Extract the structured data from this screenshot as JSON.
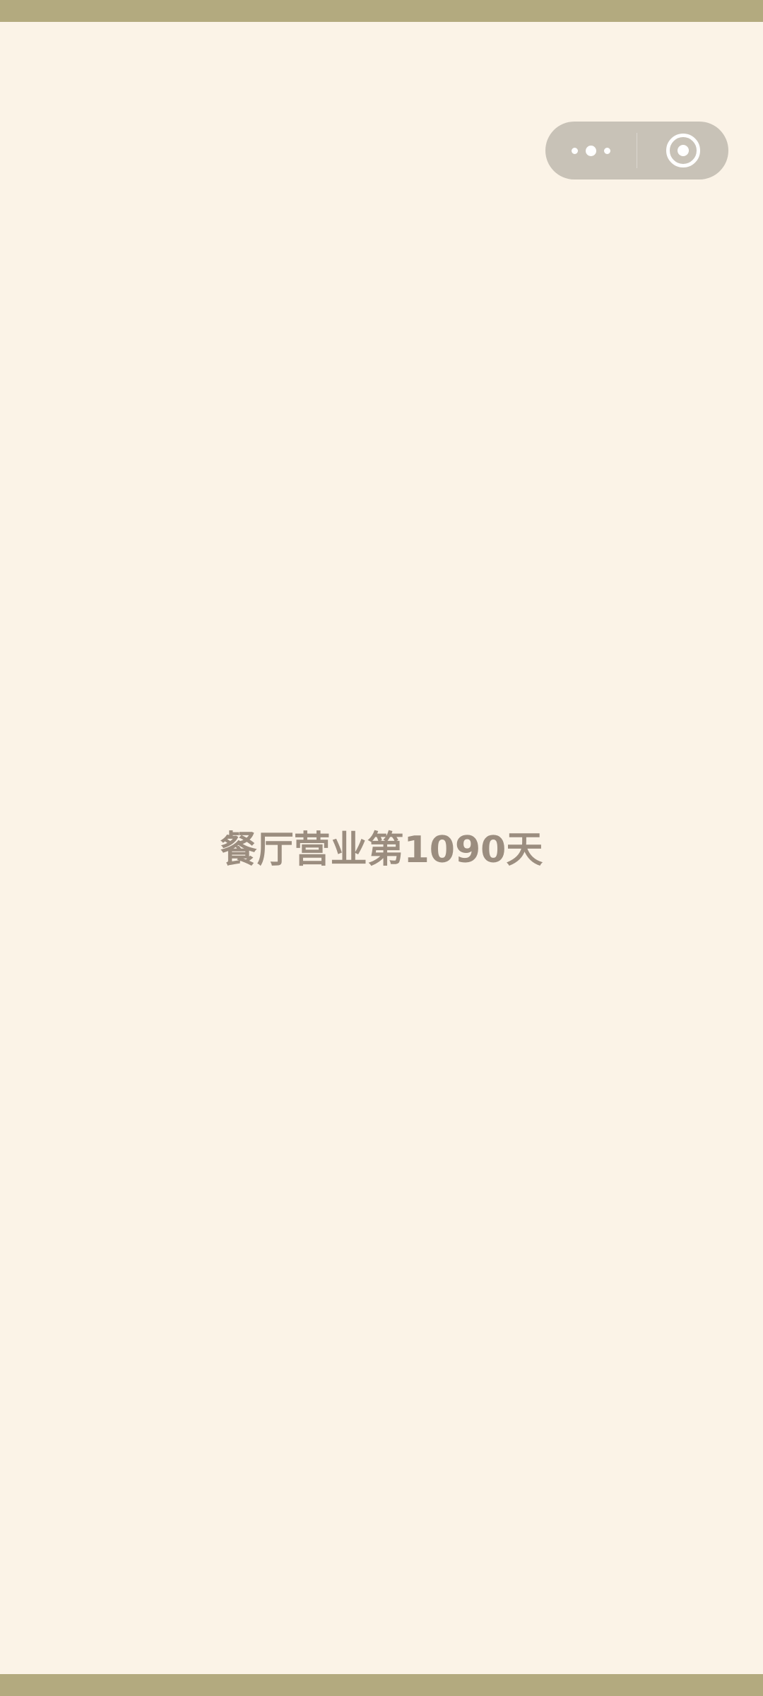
{
  "status_bar": {
    "color": "#b3aa7f"
  },
  "capsule": {
    "more_icon": "three-dots-icon",
    "close_icon": "target-circle-icon",
    "background": "#c8c2b7"
  },
  "main": {
    "message": "餐厅营业第1090天",
    "text_color": "#9b8d7f",
    "background": "#fbf3e7"
  },
  "nav_bar": {
    "color": "#b3aa7f"
  }
}
